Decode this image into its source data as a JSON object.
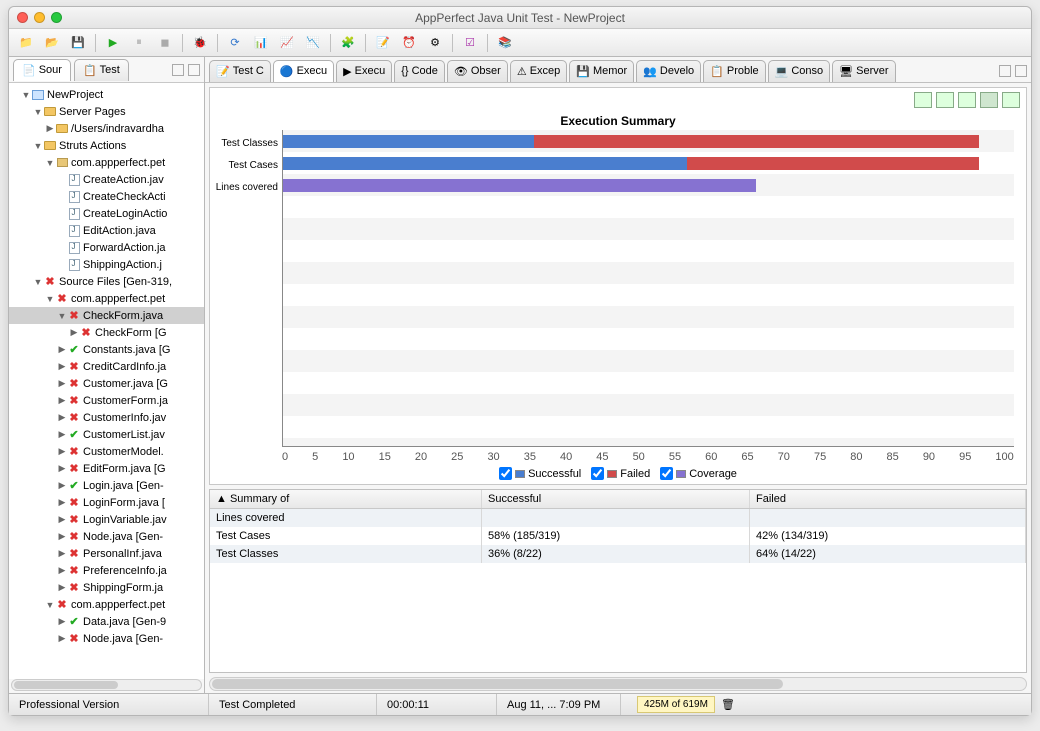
{
  "window_title": "AppPerfect Java Unit Test - NewProject",
  "status": {
    "edition": "Professional Version",
    "state": "Test Completed",
    "elapsed": "00:00:11",
    "datetime": "Aug 11, ... 7:09 PM",
    "memory": "425M of 619M"
  },
  "left_tabs": [
    {
      "name": "Sour"
    },
    {
      "name": "Test"
    }
  ],
  "right_tabs": [
    {
      "name": "Test C"
    },
    {
      "name": "Execu",
      "active": true
    },
    {
      "name": "Execu"
    },
    {
      "name": "Code"
    },
    {
      "name": "Obser"
    },
    {
      "name": "Excep"
    },
    {
      "name": "Memor"
    },
    {
      "name": "Develo"
    },
    {
      "name": "Proble"
    },
    {
      "name": "Conso"
    },
    {
      "name": "Server"
    }
  ],
  "tree": [
    {
      "d": 1,
      "t": "down",
      "i": "proj",
      "label": "NewProject"
    },
    {
      "d": 2,
      "t": "down",
      "i": "folder",
      "label": "Server Pages"
    },
    {
      "d": 3,
      "t": "right",
      "i": "folder",
      "label": "/Users/indravardha"
    },
    {
      "d": 2,
      "t": "down",
      "i": "folder",
      "label": "Struts Actions"
    },
    {
      "d": 3,
      "t": "down",
      "i": "pkg",
      "label": "com.appperfect.pet"
    },
    {
      "d": 4,
      "t": "",
      "i": "java",
      "label": "CreateAction.jav"
    },
    {
      "d": 4,
      "t": "",
      "i": "java",
      "label": "CreateCheckActi"
    },
    {
      "d": 4,
      "t": "",
      "i": "java",
      "label": "CreateLoginActio"
    },
    {
      "d": 4,
      "t": "",
      "i": "java",
      "label": "EditAction.java"
    },
    {
      "d": 4,
      "t": "",
      "i": "java",
      "label": "ForwardAction.ja"
    },
    {
      "d": 4,
      "t": "",
      "i": "java",
      "label": "ShippingAction.j"
    },
    {
      "d": 2,
      "t": "down",
      "i": "x",
      "label": "Source Files [Gen-319,"
    },
    {
      "d": 3,
      "t": "down",
      "i": "x",
      "label": "com.appperfect.pet"
    },
    {
      "d": 4,
      "t": "down",
      "i": "x",
      "label": "CheckForm.java",
      "sel": true
    },
    {
      "d": 5,
      "t": "right",
      "i": "x",
      "label": "CheckForm [G"
    },
    {
      "d": 4,
      "t": "right",
      "i": "ok",
      "label": "Constants.java [G"
    },
    {
      "d": 4,
      "t": "right",
      "i": "x",
      "label": "CreditCardInfo.ja"
    },
    {
      "d": 4,
      "t": "right",
      "i": "x",
      "label": "Customer.java [G"
    },
    {
      "d": 4,
      "t": "right",
      "i": "x",
      "label": "CustomerForm.ja"
    },
    {
      "d": 4,
      "t": "right",
      "i": "x",
      "label": "CustomerInfo.jav"
    },
    {
      "d": 4,
      "t": "right",
      "i": "ok",
      "label": "CustomerList.jav"
    },
    {
      "d": 4,
      "t": "right",
      "i": "x",
      "label": "CustomerModel."
    },
    {
      "d": 4,
      "t": "right",
      "i": "x",
      "label": "EditForm.java [G"
    },
    {
      "d": 4,
      "t": "right",
      "i": "ok",
      "label": "Login.java [Gen-"
    },
    {
      "d": 4,
      "t": "right",
      "i": "x",
      "label": "LoginForm.java ["
    },
    {
      "d": 4,
      "t": "right",
      "i": "x",
      "label": "LoginVariable.jav"
    },
    {
      "d": 4,
      "t": "right",
      "i": "x",
      "label": "Node.java [Gen-"
    },
    {
      "d": 4,
      "t": "right",
      "i": "x",
      "label": "PersonalInf.java"
    },
    {
      "d": 4,
      "t": "right",
      "i": "x",
      "label": "PreferenceInfo.ja"
    },
    {
      "d": 4,
      "t": "right",
      "i": "x",
      "label": "ShippingForm.ja"
    },
    {
      "d": 3,
      "t": "down",
      "i": "x",
      "label": "com.appperfect.pet"
    },
    {
      "d": 4,
      "t": "right",
      "i": "ok",
      "label": "Data.java [Gen-9"
    },
    {
      "d": 4,
      "t": "right",
      "i": "x",
      "label": "Node.java [Gen-"
    }
  ],
  "chart_data": {
    "type": "bar",
    "title": "Execution Summary",
    "categories": [
      "Test Classes",
      "Test Cases",
      "Lines covered"
    ],
    "series": [
      {
        "name": "Successful",
        "color": "#4a7ecf",
        "values": [
          36,
          58,
          0
        ]
      },
      {
        "name": "Failed",
        "color": "#d14b4b",
        "values": [
          64,
          42,
          0
        ]
      },
      {
        "name": "Coverage",
        "color": "#8672d1",
        "values": [
          0,
          0,
          68
        ]
      }
    ],
    "xlim": [
      0,
      105
    ],
    "xticks": [
      0,
      5,
      10,
      15,
      20,
      25,
      30,
      35,
      40,
      45,
      50,
      55,
      60,
      65,
      70,
      75,
      80,
      85,
      90,
      95,
      100
    ]
  },
  "legend": [
    "Successful",
    "Failed",
    "Coverage"
  ],
  "summary_table": {
    "headers": [
      "Summary of",
      "Successful",
      "Failed"
    ],
    "rows": [
      [
        "Lines covered",
        "",
        ""
      ],
      [
        "Test Cases",
        "58% (185/319)",
        "42% (134/319)"
      ],
      [
        "Test Classes",
        "36% (8/22)",
        "64% (14/22)"
      ]
    ]
  }
}
